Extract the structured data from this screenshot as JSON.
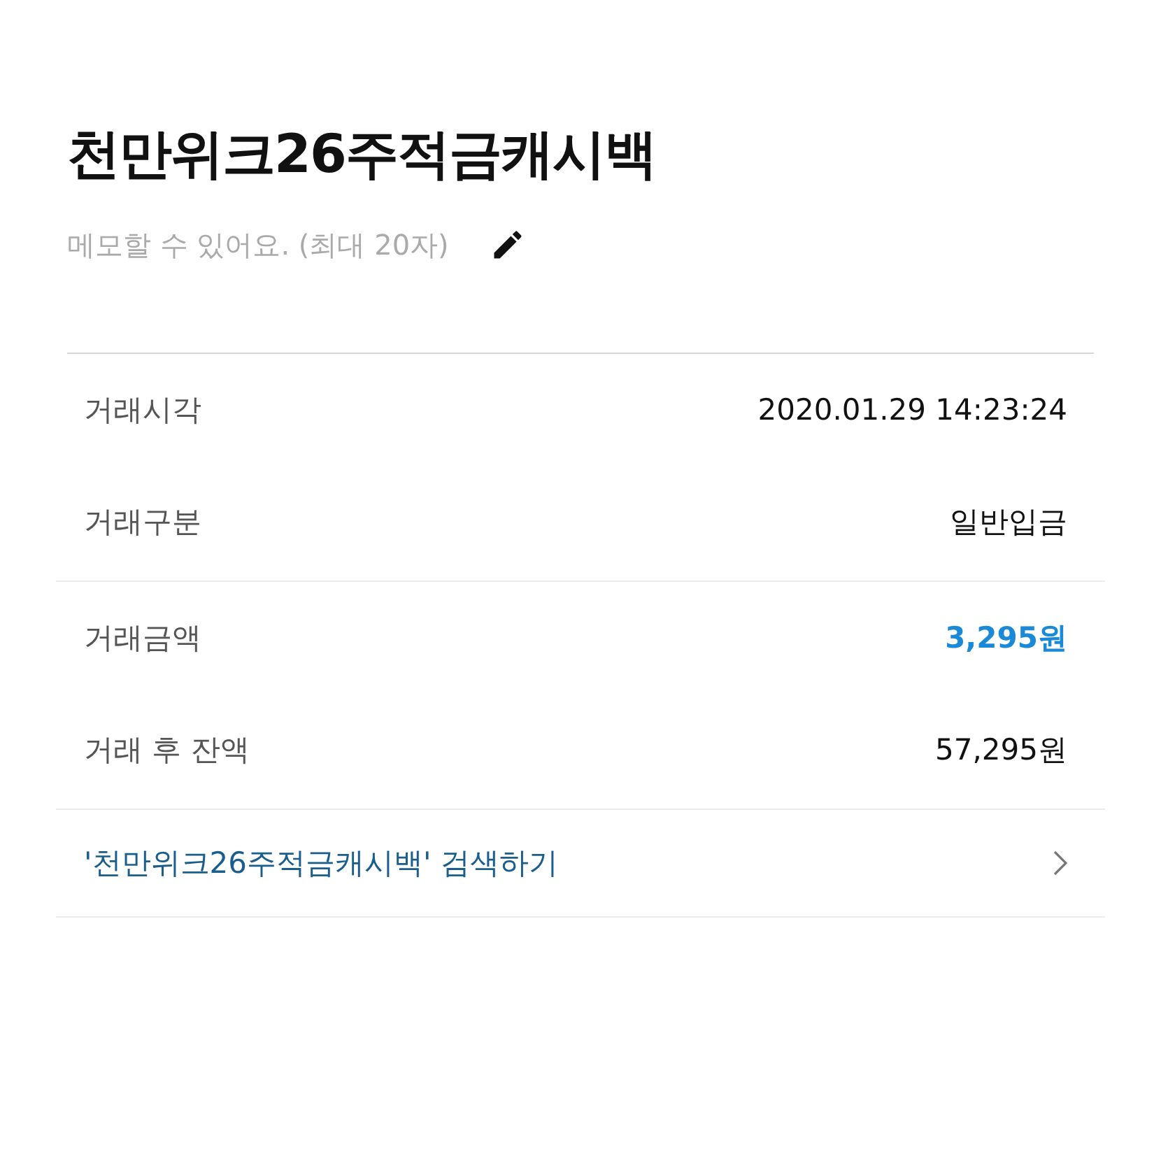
{
  "title": "천만위크26주적금캐시백",
  "memo": {
    "placeholder": "메모할 수 있어요. (최대 20자)"
  },
  "sections": [
    {
      "rows": [
        {
          "label": "거래시각",
          "value": "2020.01.29 14:23:24",
          "kind": "plain"
        },
        {
          "label": "거래구분",
          "value": "일반입금",
          "kind": "plain"
        }
      ]
    },
    {
      "rows": [
        {
          "label": "거래금액",
          "value": "3,295원",
          "kind": "amount"
        },
        {
          "label": "거래 후 잔액",
          "value": "57,295원",
          "kind": "plain"
        }
      ]
    }
  ],
  "search_link": {
    "label": "'천만위크26주적금캐시백' 검색하기"
  }
}
